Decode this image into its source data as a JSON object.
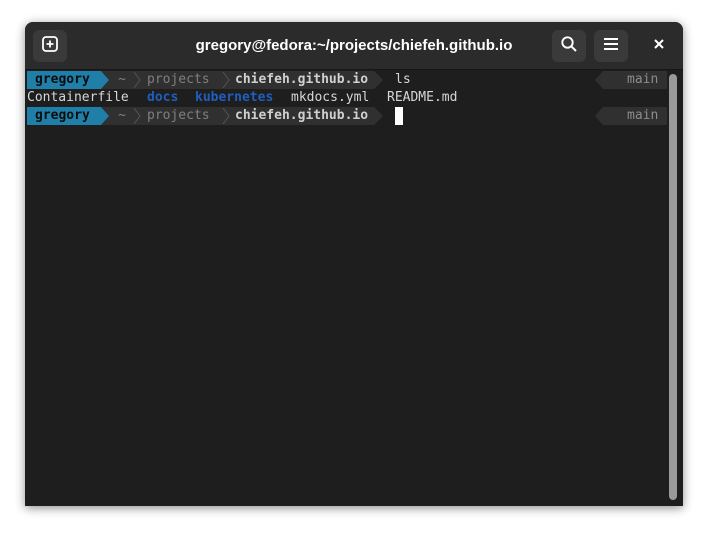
{
  "window": {
    "title": "gregory@fedora:~/projects/chiefeh.github.io"
  },
  "headerbar": {
    "new_tab_icon": "new-tab-icon",
    "search_icon": "search-icon",
    "menu_icon": "hamburger-menu-icon",
    "close_icon": "close-icon"
  },
  "prompt": {
    "user": "gregory",
    "home": "~",
    "dir": "projects",
    "cwd": "chiefeh.github.io",
    "branch": "main",
    "branch_icon": "git-branch-icon"
  },
  "lines": {
    "command": "ls"
  },
  "ls_output": [
    {
      "name": "Containerfile",
      "type": "file"
    },
    {
      "name": "docs",
      "type": "dir"
    },
    {
      "name": "kubernetes",
      "type": "dir"
    },
    {
      "name": "mkdocs.yml",
      "type": "file"
    },
    {
      "name": "README.md",
      "type": "file"
    }
  ],
  "colors": {
    "user_segment": "#1f7fa8",
    "path_segment": "#303030",
    "directory": "#1e5fc0",
    "background": "#1e1e1e",
    "headerbar": "#2b2b2b"
  }
}
